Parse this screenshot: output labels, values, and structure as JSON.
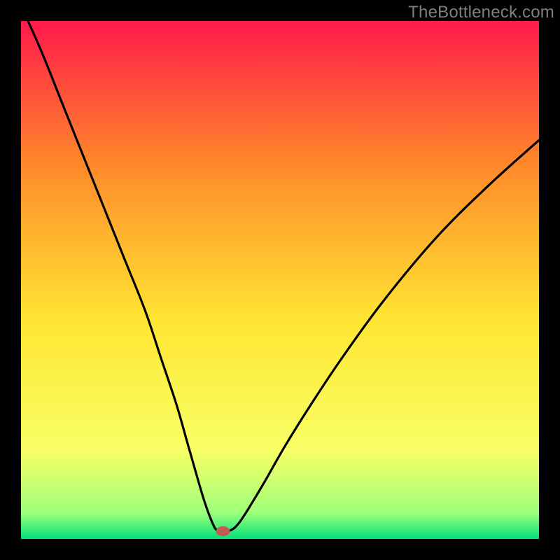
{
  "watermark": "TheBottleneck.com",
  "chart_data": {
    "type": "line",
    "title": "",
    "xlabel": "",
    "ylabel": "",
    "xlim": [
      0,
      100
    ],
    "ylim": [
      0,
      100
    ],
    "grid": false,
    "legend": false,
    "background_gradient": {
      "top": "#ff1a4b",
      "upper_mid": "#ff8a2a",
      "mid": "#ffe633",
      "lower_mid": "#f8ff66",
      "near_bottom": "#9dff7a",
      "bottom": "#00e07a"
    },
    "marker": {
      "x": 39,
      "y": 1.5,
      "color": "#c05a52"
    },
    "series": [
      {
        "name": "curve",
        "color": "#000000",
        "x": [
          0,
          4,
          8,
          12,
          16,
          20,
          24,
          27,
          30,
          32,
          34,
          35.5,
          37,
          37.8,
          38.7,
          40.5,
          42,
          44,
          47,
          51,
          56,
          62,
          70,
          80,
          90,
          100
        ],
        "y": [
          103,
          94,
          84,
          74,
          64,
          54,
          44,
          35,
          26,
          19,
          12,
          7,
          3,
          1.7,
          1.5,
          1.7,
          3,
          6,
          11,
          18,
          26,
          35,
          46,
          58,
          68,
          77
        ]
      }
    ]
  }
}
